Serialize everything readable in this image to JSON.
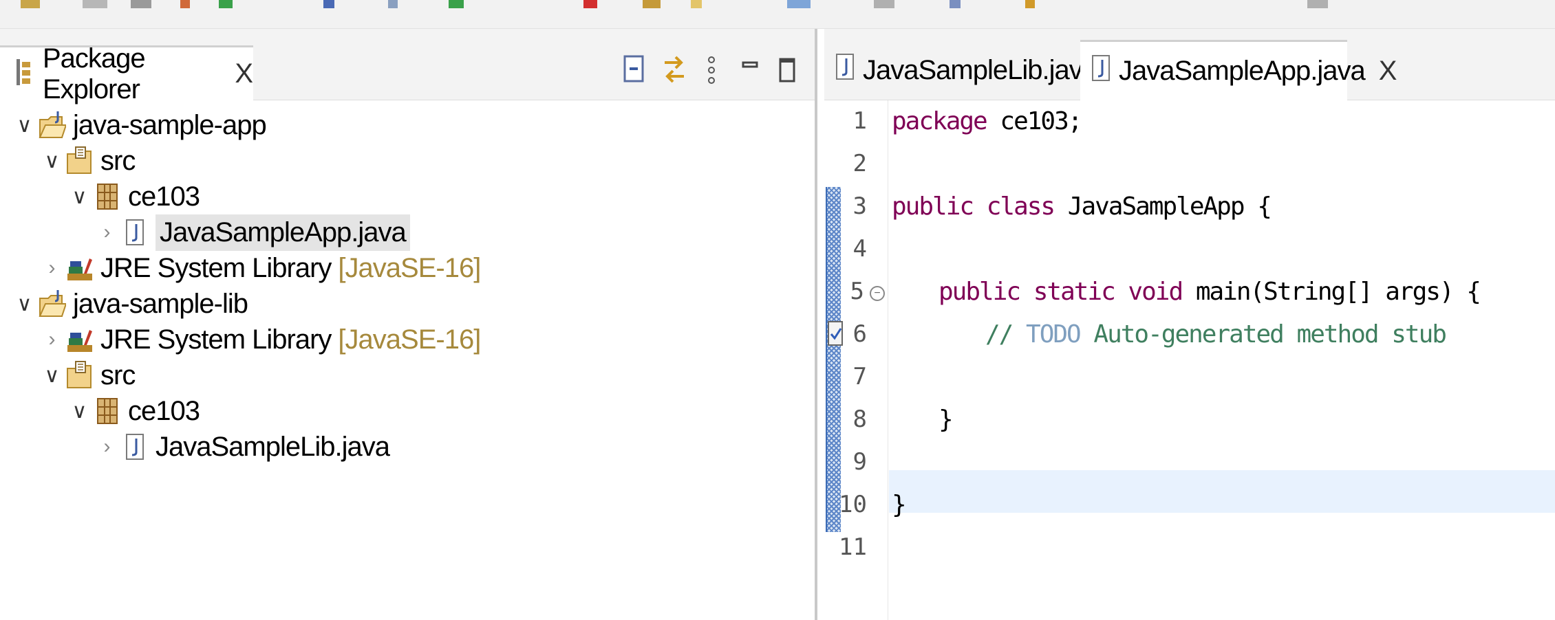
{
  "explorer": {
    "title": "Package Explorer",
    "close_glyph": "X",
    "tree": [
      {
        "label": "java-sample-app",
        "decoration": "",
        "icon": "java-project-icon",
        "expanded": true
      },
      {
        "label": "src",
        "decoration": "",
        "icon": "source-folder-icon",
        "expanded": true
      },
      {
        "label": "ce103",
        "decoration": "",
        "icon": "package-icon",
        "expanded": true
      },
      {
        "label": "JavaSampleApp.java",
        "decoration": "",
        "icon": "java-file-icon",
        "expanded": false,
        "selected": true
      },
      {
        "label": "JRE System Library",
        "decoration": "[JavaSE-16]",
        "icon": "library-icon",
        "expanded": false
      },
      {
        "label": "java-sample-lib",
        "decoration": "",
        "icon": "java-project-icon",
        "expanded": true
      },
      {
        "label": "JRE System Library",
        "decoration": "[JavaSE-16]",
        "icon": "library-icon",
        "expanded": false
      },
      {
        "label": "src",
        "decoration": "",
        "icon": "source-folder-icon",
        "expanded": true
      },
      {
        "label": "ce103",
        "decoration": "",
        "icon": "package-icon",
        "expanded": true
      },
      {
        "label": "JavaSampleLib.java",
        "decoration": "",
        "icon": "java-file-icon",
        "expanded": false
      }
    ]
  },
  "editor": {
    "tabs": [
      {
        "label": "JavaSampleLib.java",
        "active": false
      },
      {
        "label": "JavaSampleApp.java",
        "active": true,
        "close_glyph": "X"
      }
    ],
    "line_numbers": [
      "1",
      "2",
      "3",
      "4",
      "5",
      "6",
      "7",
      "8",
      "9",
      "10",
      "11"
    ],
    "code": {
      "l1_kw": "package",
      "l1_rest": " ce103;",
      "l3_kw": "public class",
      "l3_rest": " JavaSampleApp {",
      "l5_kw": "public static void",
      "l5_rest": " main(String[] args) {",
      "l6_comment": "// ",
      "l6_todo": "TODO",
      "l6_comment_rest": " Auto-generated method stub",
      "l8": "}",
      "l10": "}"
    },
    "current_line": 9
  },
  "colors": {
    "keyword": "#7f0055",
    "comment": "#3f7f5f",
    "todo": "#7f9fbf",
    "current_line": "#e8f2fe",
    "decoration": "#a6893c"
  }
}
